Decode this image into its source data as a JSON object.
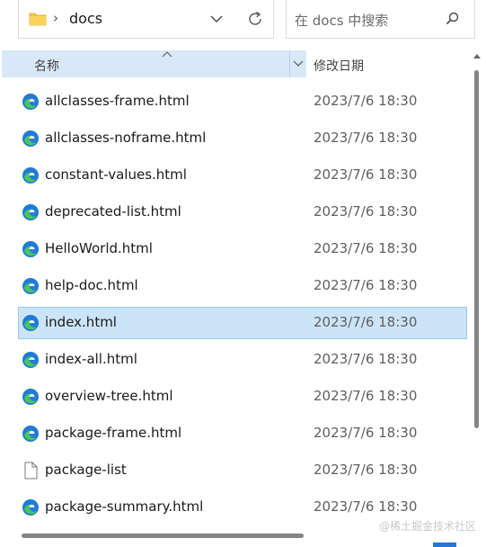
{
  "address": {
    "path_separator": "›",
    "current_folder": "docs"
  },
  "search": {
    "placeholder": "在 docs 中搜索"
  },
  "columns": {
    "name": "名称",
    "date_modified": "修改日期"
  },
  "files": [
    {
      "name": "allclasses-frame.html",
      "date": "2023/7/6 18:30",
      "icon": "edge-html-icon",
      "selected": false
    },
    {
      "name": "allclasses-noframe.html",
      "date": "2023/7/6 18:30",
      "icon": "edge-html-icon",
      "selected": false
    },
    {
      "name": "constant-values.html",
      "date": "2023/7/6 18:30",
      "icon": "edge-html-icon",
      "selected": false
    },
    {
      "name": "deprecated-list.html",
      "date": "2023/7/6 18:30",
      "icon": "edge-html-icon",
      "selected": false
    },
    {
      "name": "HelloWorld.html",
      "date": "2023/7/6 18:30",
      "icon": "edge-html-icon",
      "selected": false
    },
    {
      "name": "help-doc.html",
      "date": "2023/7/6 18:30",
      "icon": "edge-html-icon",
      "selected": false
    },
    {
      "name": "index.html",
      "date": "2023/7/6 18:30",
      "icon": "edge-html-icon",
      "selected": true
    },
    {
      "name": "index-all.html",
      "date": "2023/7/6 18:30",
      "icon": "edge-html-icon",
      "selected": false
    },
    {
      "name": "overview-tree.html",
      "date": "2023/7/6 18:30",
      "icon": "edge-html-icon",
      "selected": false
    },
    {
      "name": "package-frame.html",
      "date": "2023/7/6 18:30",
      "icon": "edge-html-icon",
      "selected": false
    },
    {
      "name": "package-list",
      "date": "2023/7/6 18:30",
      "icon": "blank-file-icon",
      "selected": false
    },
    {
      "name": "package-summary.html",
      "date": "2023/7/6 18:30",
      "icon": "edge-html-icon",
      "selected": false
    }
  ],
  "watermark": "@稀土掘金技术社区",
  "colors": {
    "selection_bg": "#cce4f7",
    "header_bg": "#d9e8f7",
    "folder_yellow": "#f4c542",
    "edge_blue": "#1f7bd6",
    "edge_green": "#4cc45c"
  }
}
